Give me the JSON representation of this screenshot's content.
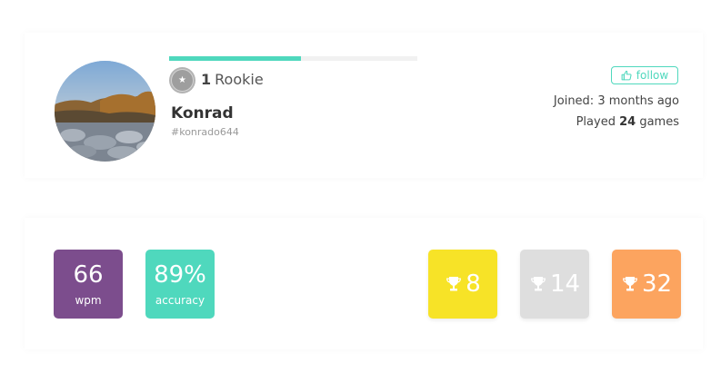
{
  "profile": {
    "level_progress": 0.53,
    "rank_level": "1",
    "rank_name": "Rookie",
    "rank_icon": "star-icon",
    "username": "Konrad",
    "tag": "#konrado644",
    "follow_label": "follow",
    "joined": "Joined: 3 months ago",
    "played_prefix": "Played",
    "played_count": "24",
    "played_suffix": "games"
  },
  "stats": {
    "wpm": {
      "value": "66",
      "unit": "wpm"
    },
    "accuracy": {
      "value": "89%",
      "unit": "accuracy"
    }
  },
  "trophies": [
    {
      "count": "8",
      "color": "#f7e327"
    },
    {
      "count": "14",
      "color": "#dedede"
    },
    {
      "count": "32",
      "color": "#fca45f"
    }
  ],
  "colors": {
    "accent": "#4fd8bd",
    "wpm": "#7c4d8d"
  }
}
